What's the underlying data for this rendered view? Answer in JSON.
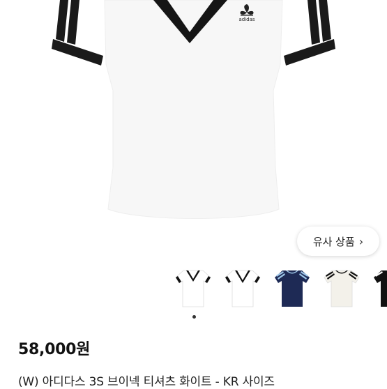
{
  "product": {
    "logo_text": "adidas",
    "similar_label": "유사 상품",
    "similar_chevron": "chevron-right-icon",
    "price": "58,000원",
    "title": "(W) 아디다스 3S 브이넥 티셔츠 화이트 - KR 사이즈"
  },
  "thumbnails": [
    {
      "name": "white-vneck-front",
      "body": "#ffffff",
      "trim": "#111111"
    },
    {
      "name": "white-vneck-alt",
      "body": "#ffffff",
      "trim": "#111111"
    },
    {
      "name": "navy-tee",
      "body": "#1e2a55",
      "trim": "#9ec6e8"
    },
    {
      "name": "cream-tee",
      "body": "#f3f1ea",
      "trim": "#111111"
    },
    {
      "name": "black-tee-partial",
      "body": "#111111",
      "trim": "#ffffff"
    }
  ],
  "carousel": {
    "active_index": 0
  },
  "colors": {
    "trim": "#111111",
    "shirt": "#ffffff"
  }
}
